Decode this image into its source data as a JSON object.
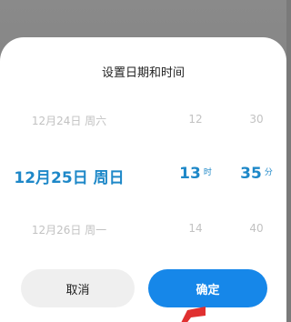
{
  "dialog": {
    "title": "设置日期和时间",
    "cancel_label": "取消",
    "confirm_label": "确定"
  },
  "picker": {
    "date": {
      "prev": "12月24日  周六",
      "selected": "12月25日  周日",
      "next": "12月26日  周一"
    },
    "hour": {
      "prev": "12",
      "selected": "13",
      "unit": "时",
      "next": "14"
    },
    "minute": {
      "prev": "30",
      "selected": "35",
      "unit": "分",
      "next": "40"
    }
  },
  "colors": {
    "accent": "#1687e9",
    "selected_text": "#1e88c8",
    "dim_text": "#c2c2c2",
    "annotation_arrow": "#e03030"
  }
}
